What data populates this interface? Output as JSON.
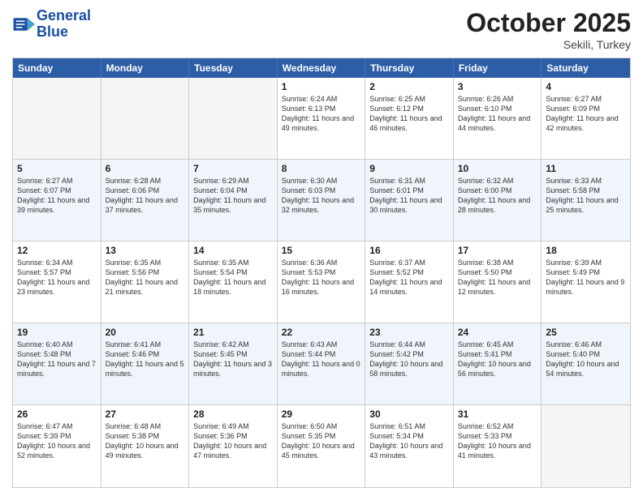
{
  "header": {
    "logo_line1": "General",
    "logo_line2": "Blue",
    "month": "October 2025",
    "location": "Sekili, Turkey"
  },
  "days_of_week": [
    "Sunday",
    "Monday",
    "Tuesday",
    "Wednesday",
    "Thursday",
    "Friday",
    "Saturday"
  ],
  "weeks": [
    [
      {
        "day": "",
        "text": ""
      },
      {
        "day": "",
        "text": ""
      },
      {
        "day": "",
        "text": ""
      },
      {
        "day": "1",
        "text": "Sunrise: 6:24 AM\nSunset: 6:13 PM\nDaylight: 11 hours and 49 minutes."
      },
      {
        "day": "2",
        "text": "Sunrise: 6:25 AM\nSunset: 6:12 PM\nDaylight: 11 hours and 46 minutes."
      },
      {
        "day": "3",
        "text": "Sunrise: 6:26 AM\nSunset: 6:10 PM\nDaylight: 11 hours and 44 minutes."
      },
      {
        "day": "4",
        "text": "Sunrise: 6:27 AM\nSunset: 6:09 PM\nDaylight: 11 hours and 42 minutes."
      }
    ],
    [
      {
        "day": "5",
        "text": "Sunrise: 6:27 AM\nSunset: 6:07 PM\nDaylight: 11 hours and 39 minutes."
      },
      {
        "day": "6",
        "text": "Sunrise: 6:28 AM\nSunset: 6:06 PM\nDaylight: 11 hours and 37 minutes."
      },
      {
        "day": "7",
        "text": "Sunrise: 6:29 AM\nSunset: 6:04 PM\nDaylight: 11 hours and 35 minutes."
      },
      {
        "day": "8",
        "text": "Sunrise: 6:30 AM\nSunset: 6:03 PM\nDaylight: 11 hours and 32 minutes."
      },
      {
        "day": "9",
        "text": "Sunrise: 6:31 AM\nSunset: 6:01 PM\nDaylight: 11 hours and 30 minutes."
      },
      {
        "day": "10",
        "text": "Sunrise: 6:32 AM\nSunset: 6:00 PM\nDaylight: 11 hours and 28 minutes."
      },
      {
        "day": "11",
        "text": "Sunrise: 6:33 AM\nSunset: 5:58 PM\nDaylight: 11 hours and 25 minutes."
      }
    ],
    [
      {
        "day": "12",
        "text": "Sunrise: 6:34 AM\nSunset: 5:57 PM\nDaylight: 11 hours and 23 minutes."
      },
      {
        "day": "13",
        "text": "Sunrise: 6:35 AM\nSunset: 5:56 PM\nDaylight: 11 hours and 21 minutes."
      },
      {
        "day": "14",
        "text": "Sunrise: 6:35 AM\nSunset: 5:54 PM\nDaylight: 11 hours and 18 minutes."
      },
      {
        "day": "15",
        "text": "Sunrise: 6:36 AM\nSunset: 5:53 PM\nDaylight: 11 hours and 16 minutes."
      },
      {
        "day": "16",
        "text": "Sunrise: 6:37 AM\nSunset: 5:52 PM\nDaylight: 11 hours and 14 minutes."
      },
      {
        "day": "17",
        "text": "Sunrise: 6:38 AM\nSunset: 5:50 PM\nDaylight: 11 hours and 12 minutes."
      },
      {
        "day": "18",
        "text": "Sunrise: 6:39 AM\nSunset: 5:49 PM\nDaylight: 11 hours and 9 minutes."
      }
    ],
    [
      {
        "day": "19",
        "text": "Sunrise: 6:40 AM\nSunset: 5:48 PM\nDaylight: 11 hours and 7 minutes."
      },
      {
        "day": "20",
        "text": "Sunrise: 6:41 AM\nSunset: 5:46 PM\nDaylight: 11 hours and 5 minutes."
      },
      {
        "day": "21",
        "text": "Sunrise: 6:42 AM\nSunset: 5:45 PM\nDaylight: 11 hours and 3 minutes."
      },
      {
        "day": "22",
        "text": "Sunrise: 6:43 AM\nSunset: 5:44 PM\nDaylight: 11 hours and 0 minutes."
      },
      {
        "day": "23",
        "text": "Sunrise: 6:44 AM\nSunset: 5:42 PM\nDaylight: 10 hours and 58 minutes."
      },
      {
        "day": "24",
        "text": "Sunrise: 6:45 AM\nSunset: 5:41 PM\nDaylight: 10 hours and 56 minutes."
      },
      {
        "day": "25",
        "text": "Sunrise: 6:46 AM\nSunset: 5:40 PM\nDaylight: 10 hours and 54 minutes."
      }
    ],
    [
      {
        "day": "26",
        "text": "Sunrise: 6:47 AM\nSunset: 5:39 PM\nDaylight: 10 hours and 52 minutes."
      },
      {
        "day": "27",
        "text": "Sunrise: 6:48 AM\nSunset: 5:38 PM\nDaylight: 10 hours and 49 minutes."
      },
      {
        "day": "28",
        "text": "Sunrise: 6:49 AM\nSunset: 5:36 PM\nDaylight: 10 hours and 47 minutes."
      },
      {
        "day": "29",
        "text": "Sunrise: 6:50 AM\nSunset: 5:35 PM\nDaylight: 10 hours and 45 minutes."
      },
      {
        "day": "30",
        "text": "Sunrise: 6:51 AM\nSunset: 5:34 PM\nDaylight: 10 hours and 43 minutes."
      },
      {
        "day": "31",
        "text": "Sunrise: 6:52 AM\nSunset: 5:33 PM\nDaylight: 10 hours and 41 minutes."
      },
      {
        "day": "",
        "text": ""
      }
    ]
  ]
}
